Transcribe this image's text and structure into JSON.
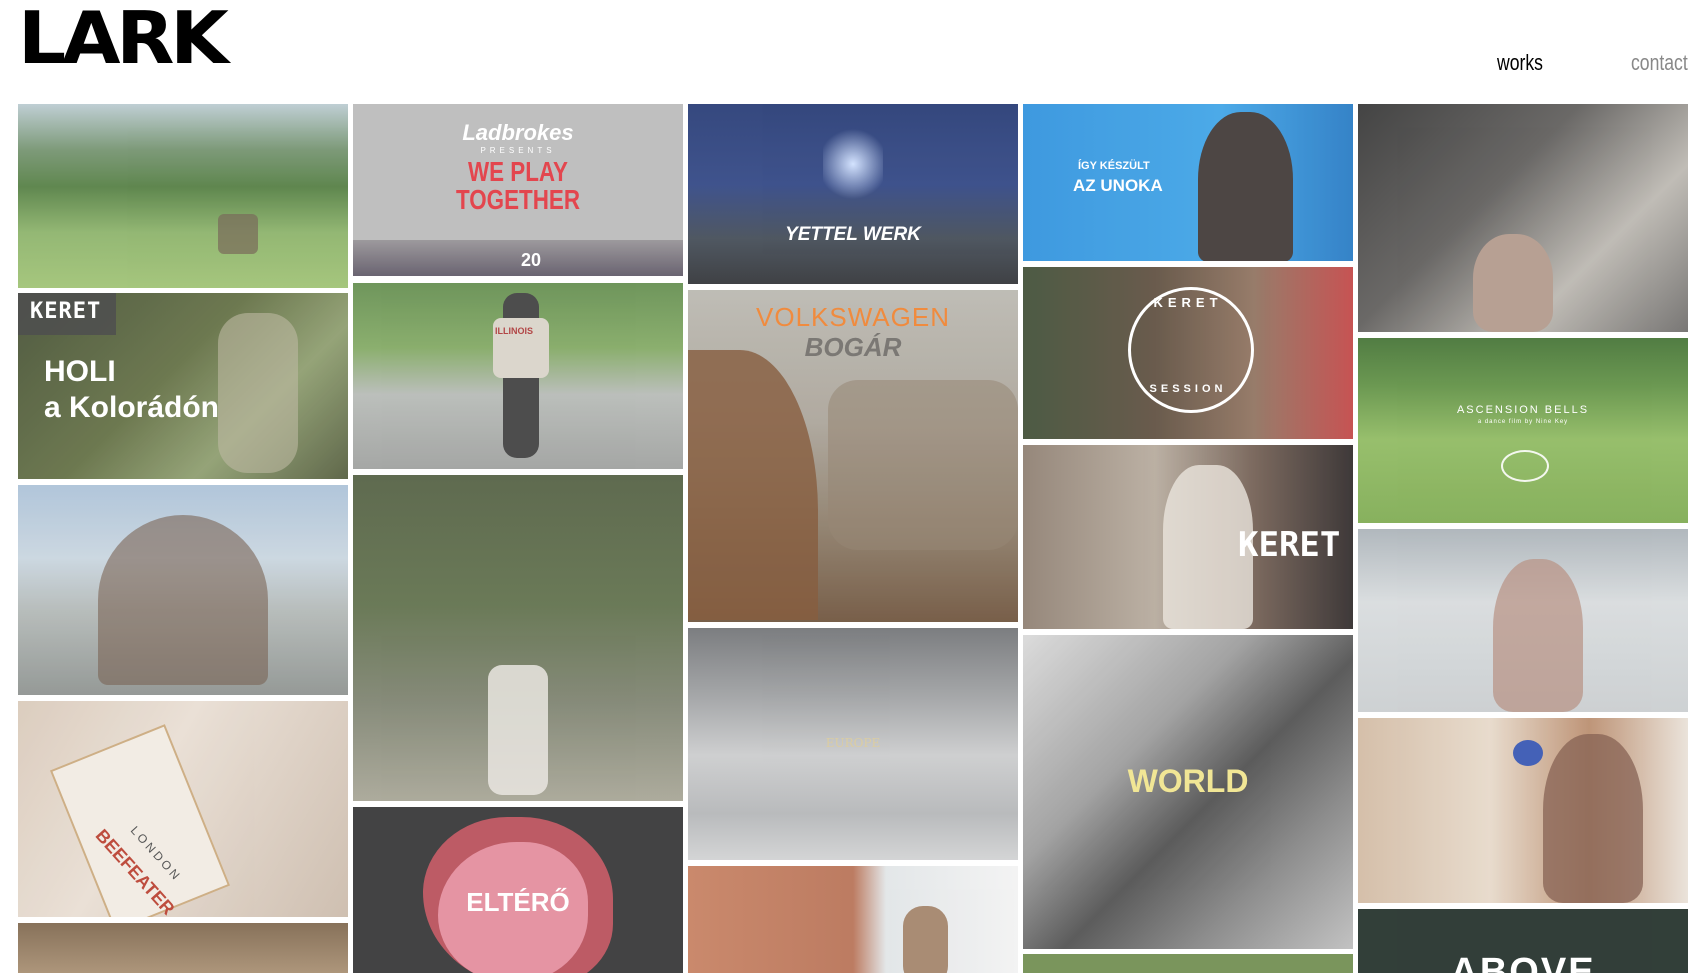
{
  "site": {
    "logo": "LARK"
  },
  "nav": {
    "works": "works",
    "contact": "contact"
  },
  "tiles": {
    "ladbrokes": {
      "brand": "Ladbrokes",
      "presents": "PRESENTS",
      "title1": "WE PLAY",
      "title2": "TOGETHER",
      "jersey": "20"
    },
    "yettel": {
      "title": "YETTEL WERK"
    },
    "unoka": {
      "line1": "ÍGY KÉSZÜLT",
      "line2": "AZ UNOKA"
    },
    "holi": {
      "logo": "KERET",
      "line1": "HOLI",
      "line2": "a Kolorádón"
    },
    "keret_session": {
      "top": "KERET",
      "bottom": "SESSION"
    },
    "ascension": {
      "title": "ASCENSION BELLS",
      "subtitle": "a dance film by Nine Key"
    },
    "volkswagen": {
      "line1": "VOLKSWAGEN",
      "line2": "BOGÁR"
    },
    "illinois": {
      "shirt": "ILLINOIS"
    },
    "keret_sign": {
      "sign": "KERET"
    },
    "beefeater": {
      "brand": "BEEFEATER",
      "city": "LONDON"
    },
    "europe": {
      "title": "EUROPE"
    },
    "world": {
      "title": "WORLD"
    },
    "eltero": {
      "title": "ELTÉRŐ"
    },
    "above": {
      "title": "ABOVE"
    }
  }
}
